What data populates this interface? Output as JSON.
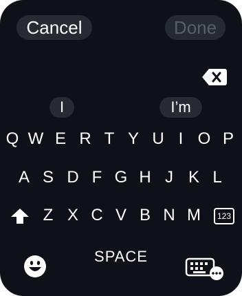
{
  "header": {
    "cancel_label": "Cancel",
    "done_label": "Done"
  },
  "suggestions": [
    "I",
    "I’m"
  ],
  "keyboard": {
    "row1": [
      "Q",
      "W",
      "E",
      "R",
      "T",
      "Y",
      "U",
      "I",
      "O",
      "P"
    ],
    "row2": [
      "A",
      "S",
      "D",
      "F",
      "G",
      "H",
      "J",
      "K",
      "L"
    ],
    "row3": [
      "Z",
      "X",
      "C",
      "V",
      "B",
      "N",
      "M"
    ],
    "numbers_label": "123",
    "space_label": "SPACE"
  },
  "icons": {
    "backspace": "delete-backward-icon",
    "shift": "shift-arrow-icon",
    "numbers": "numbers-123-icon",
    "emoji": "emoji-smiley-icon",
    "keyboard_switch": "keyboard-more-icon"
  },
  "colors": {
    "background": "#0e1118",
    "pill": "#262a33",
    "text": "#ffffff",
    "disabled_text": "#5a5e66"
  }
}
